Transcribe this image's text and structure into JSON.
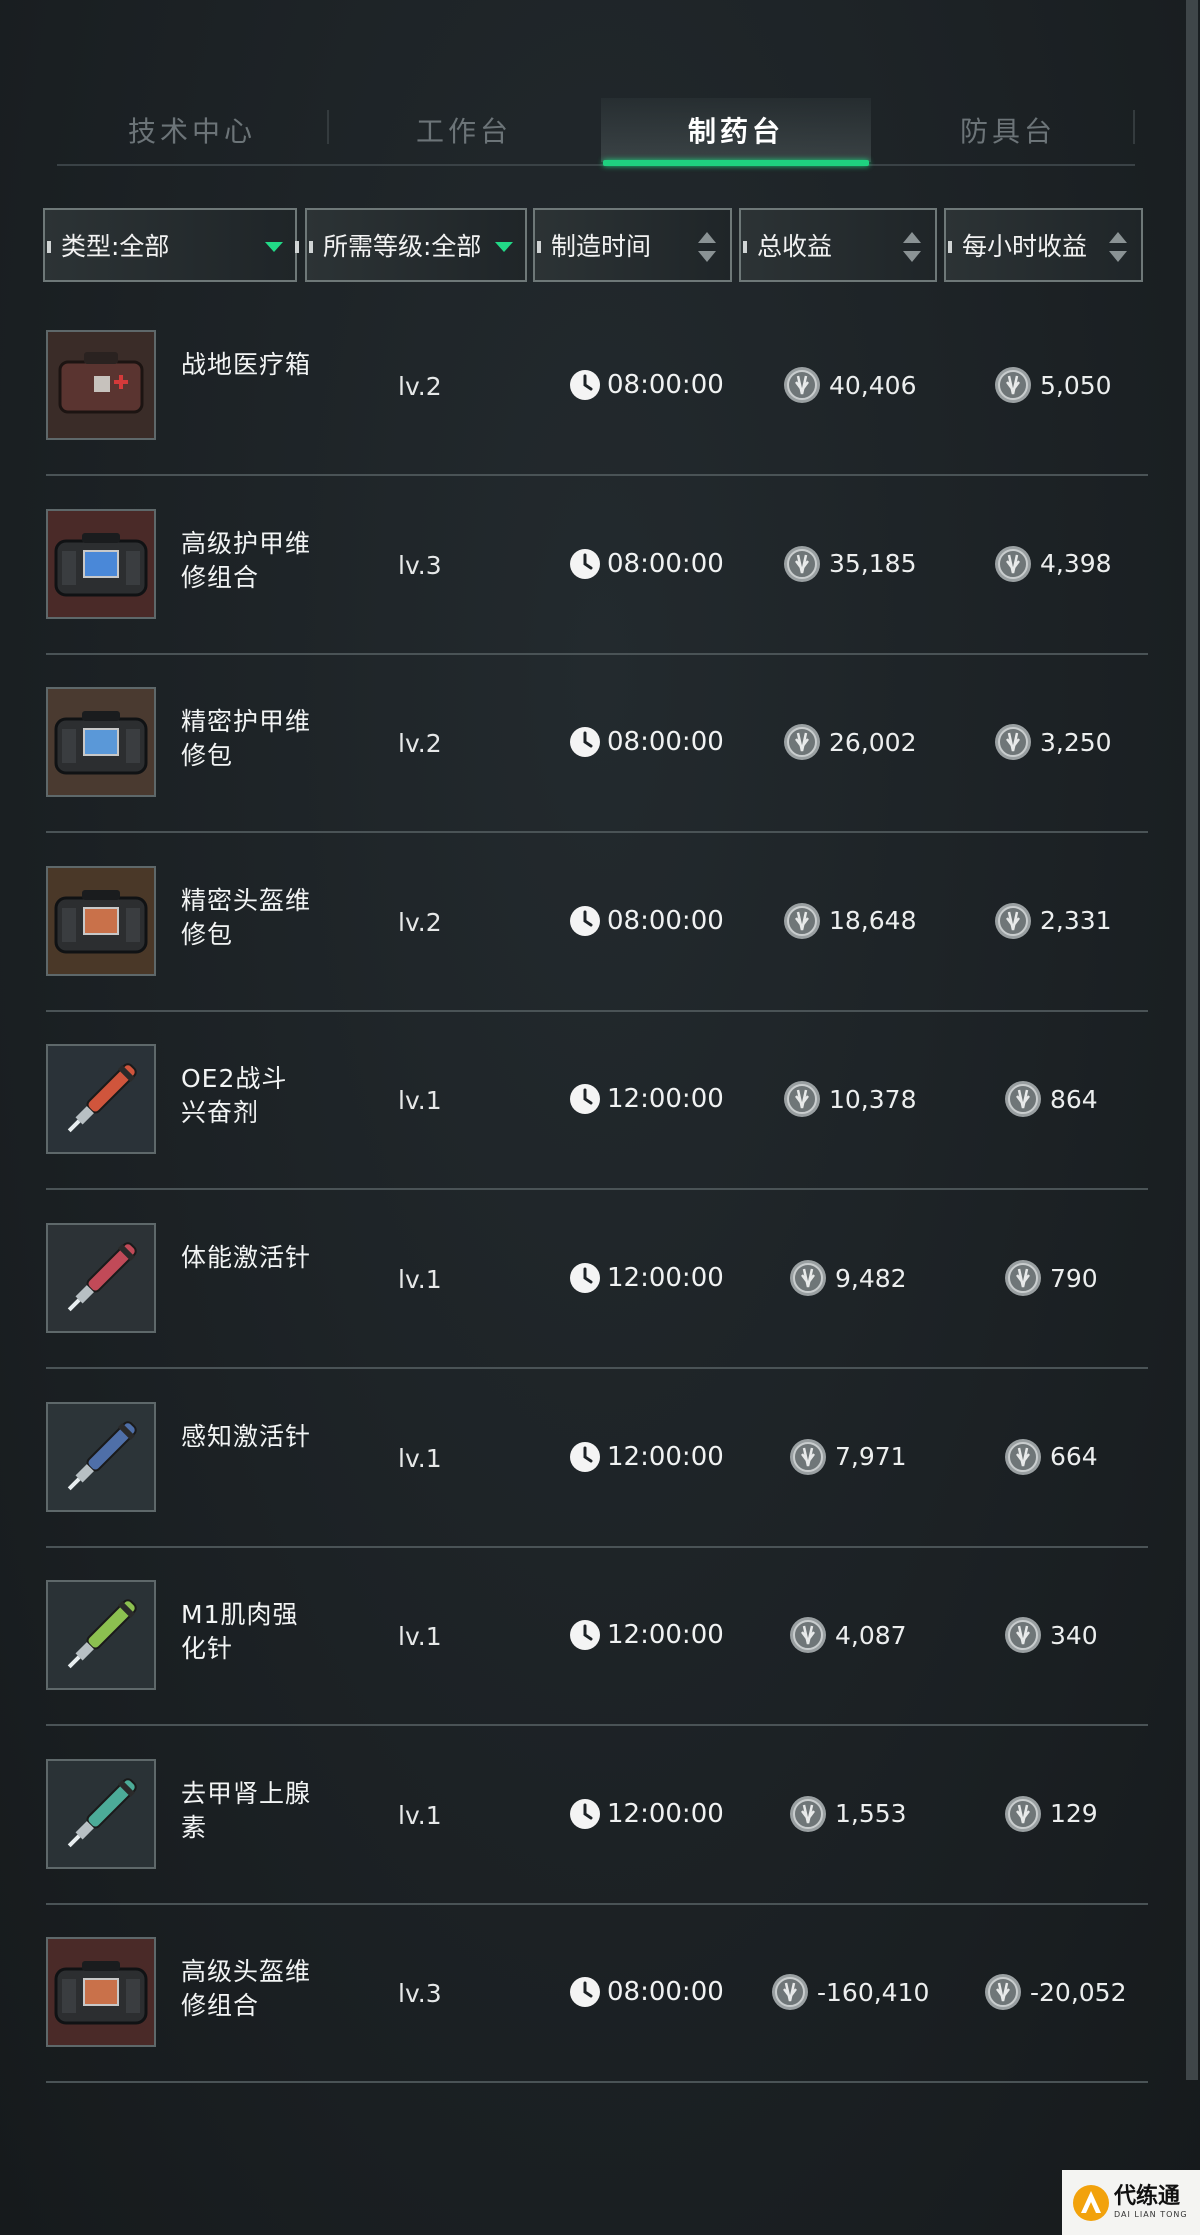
{
  "tabs": [
    {
      "label": "技术中心"
    },
    {
      "label": "工作台"
    },
    {
      "label": "制药台",
      "active": true
    },
    {
      "label": "防具台"
    }
  ],
  "filters": {
    "type": "类型:全部",
    "level": "所需等级:全部",
    "time": "制造时间",
    "total": "总收益",
    "hourly": "每小时收益"
  },
  "rows": [
    {
      "name": "战地医疗箱",
      "level": "lv.2",
      "time": "08:00:00",
      "total": "40,406",
      "hourly": "5,050",
      "icon": "medkit-icon"
    },
    {
      "name": "高级护甲维修组合",
      "level": "lv.3",
      "time": "08:00:00",
      "total": "35,185",
      "hourly": "4,398",
      "icon": "armor-repair-kit-icon"
    },
    {
      "name": "精密护甲维修包",
      "level": "lv.2",
      "time": "08:00:00",
      "total": "26,002",
      "hourly": "3,250",
      "icon": "armor-repair-bag-icon"
    },
    {
      "name": "精密头盔维修包",
      "level": "lv.2",
      "time": "08:00:00",
      "total": "18,648",
      "hourly": "2,331",
      "icon": "helmet-repair-bag-icon"
    },
    {
      "name": "OE2战斗兴奋剂",
      "level": "lv.1",
      "time": "12:00:00",
      "total": "10,378",
      "hourly": "864",
      "icon": "stimulant-injector-icon"
    },
    {
      "name": "体能激活针",
      "level": "lv.1",
      "time": "12:00:00",
      "total": "9,482",
      "hourly": "790",
      "icon": "stamina-injector-icon"
    },
    {
      "name": "感知激活针",
      "level": "lv.1",
      "time": "12:00:00",
      "total": "7,971",
      "hourly": "664",
      "icon": "perception-injector-icon"
    },
    {
      "name": "M1肌肉强化针",
      "level": "lv.1",
      "time": "12:00:00",
      "total": "4,087",
      "hourly": "340",
      "icon": "muscle-injector-icon"
    },
    {
      "name": "去甲肾上腺素",
      "level": "lv.1",
      "time": "12:00:00",
      "total": "1,553",
      "hourly": "129",
      "icon": "norepinephrine-injector-icon"
    },
    {
      "name": "高级头盔维修组合",
      "level": "lv.3",
      "time": "08:00:00",
      "total": "-160,410",
      "hourly": "-20,052",
      "icon": "helmet-repair-kit-icon"
    }
  ],
  "watermark": {
    "title": "代练通",
    "subtitle": "DAI LIAN TONG"
  },
  "colors": {
    "accent": "#1fd17f",
    "background": "#1d2226",
    "divider": "#4a5356"
  }
}
